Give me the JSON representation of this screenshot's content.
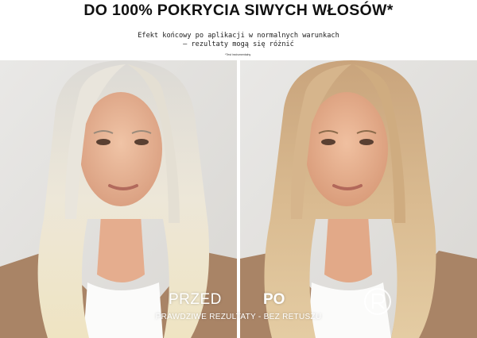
{
  "headline": "DO 100% POKRYCIA SIWYCH WŁOSÓW*",
  "subtitle": {
    "line1": "Efekt końcowy po aplikacji w normalnych warunkach",
    "line2": "– rezultaty mogą się różnić"
  },
  "footnote": "*Test instrumentalny",
  "before_label": "PRZED",
  "after_label": "PO",
  "caption": "PRAWDZIWE REZULTATY - BEZ RETUSZU",
  "icons": {
    "brand": "brand-r-logo-icon"
  },
  "colors": {
    "background": "#ffffff",
    "before_hair": "#e7e2d6",
    "after_hair": "#d4b48c",
    "skin": "#e8b797",
    "jacket": "#a88465"
  }
}
